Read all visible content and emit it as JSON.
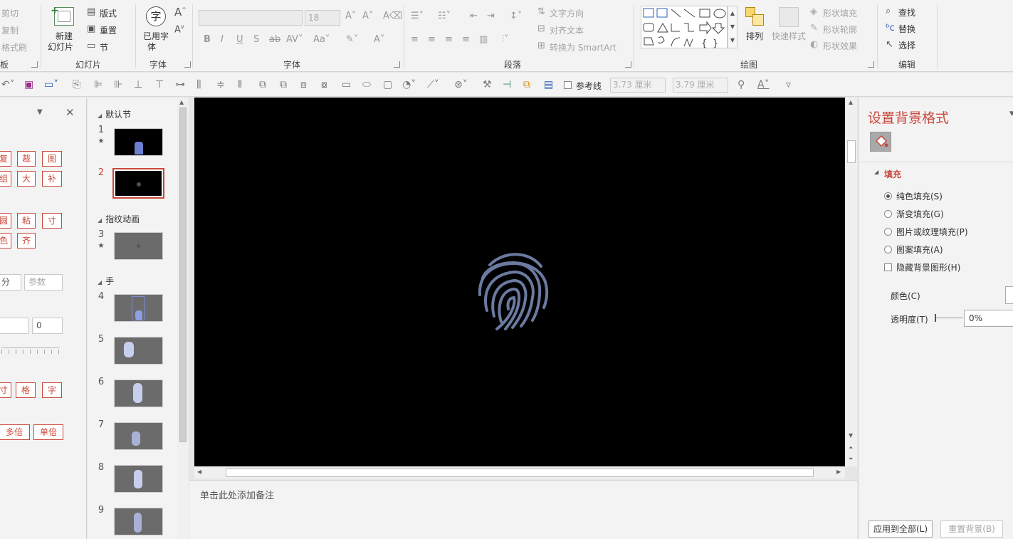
{
  "ribbon": {
    "clipboard": {
      "cut": "剪切",
      "copy": "复制",
      "format_painter": "格式刷"
    },
    "slides": {
      "new_slide": "新建",
      "new_slide2": "幻灯片",
      "layout": "版式",
      "reset": "重置",
      "section": "节",
      "group_label": "幻灯片"
    },
    "font_group": {
      "used_font": "已用字",
      "used_font2": "体",
      "group_label": "字体",
      "font_size": "18",
      "group_label2": "字体"
    },
    "paragraph": {
      "text_direction": "文字方向",
      "align_text": "对齐文本",
      "convert_smartart": "转换为 SmartArt",
      "group_label": "段落"
    },
    "drawing": {
      "arrange": "排列",
      "quick_styles": "快速样式",
      "shape_fill": "形状填充",
      "shape_outline": "形状轮廓",
      "shape_effects": "形状效果",
      "group_label": "绘图"
    },
    "editing": {
      "find": "查找",
      "replace": "替换",
      "select": "选择",
      "group_label": "编辑"
    }
  },
  "qat": {
    "guides": "参考线",
    "width": "3.73 厘米",
    "height": "3.79 厘米"
  },
  "left_panel": {
    "buttons_row1": [
      "复",
      "裁",
      "图"
    ],
    "buttons_row2": [
      "组",
      "大",
      "补"
    ],
    "buttons_row3": [
      "圆",
      "粘",
      "寸"
    ],
    "buttons_row4": [
      "色",
      "齐"
    ],
    "input_a": "分",
    "input_b_placeholder": "参数",
    "input_c": "",
    "input_d": "0",
    "buttons_row5": [
      "寸",
      "格",
      "字"
    ],
    "multi": "多倍",
    "single": "单倍"
  },
  "thumbnails": {
    "section1": "默认节",
    "section2": "指纹动画",
    "section3": "手",
    "slides": [
      "1",
      "2",
      "3",
      "4",
      "5",
      "6",
      "7",
      "8",
      "9"
    ]
  },
  "notes": {
    "placeholder": "单击此处添加备注"
  },
  "format_pane": {
    "title": "设置背景格式",
    "fill_header": "填充",
    "solid": "纯色填充(S)",
    "gradient": "渐变填充(G)",
    "picture": "图片或纹理填充(P)",
    "pattern": "图案填充(A)",
    "hide_bg": "隐藏背景图形(H)",
    "color": "颜色(C)",
    "transparency": "透明度(T)",
    "transparency_value": "0%",
    "apply_all": "应用到全部(L)",
    "reset_bg": "重置背景(B)"
  },
  "colors": {
    "accent": "#c9473a",
    "fingerprint": "#6a7aa0",
    "slide_bg": "#000000"
  }
}
